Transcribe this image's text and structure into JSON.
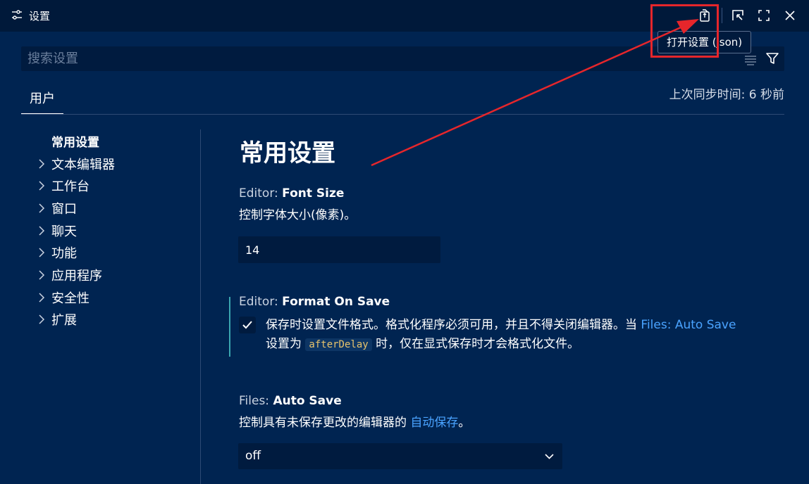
{
  "window": {
    "title": "设置",
    "tooltip": "打开设置 (json)"
  },
  "search": {
    "placeholder": "搜索设置"
  },
  "tabs": [
    {
      "label": "用户"
    }
  ],
  "sync_status": "上次同步时间: 6 秒前",
  "toc": [
    {
      "label": "常用设置",
      "active": true
    },
    {
      "label": "文本编辑器"
    },
    {
      "label": "工作台"
    },
    {
      "label": "窗口"
    },
    {
      "label": "聊天"
    },
    {
      "label": "功能"
    },
    {
      "label": "应用程序"
    },
    {
      "label": "安全性"
    },
    {
      "label": "扩展"
    }
  ],
  "section_title": "常用设置",
  "settings": {
    "font_size": {
      "category": "Editor: ",
      "name": "Font Size",
      "description": "控制字体大小(像素)。",
      "value": "14"
    },
    "format_on_save": {
      "category": "Editor: ",
      "name": "Format On Save",
      "checked": true,
      "desc_part1": "保存时设置文件格式。格式化程序必须可用，并且不得关闭编辑器。当 ",
      "desc_link": "Files: Auto Save",
      "desc_part2": "设置为 ",
      "desc_code": "afterDelay",
      "desc_part3": " 时，仅在显式保存时才会格式化文件。"
    },
    "auto_save": {
      "category": "Files: ",
      "name": "Auto Save",
      "desc_part1": "控制具有未保存更改的编辑器的 ",
      "desc_link": "自动保存",
      "desc_part2": "。",
      "value": "off"
    }
  },
  "colors": {
    "background": "#002451",
    "titlebar": "#00193a",
    "link": "#4aa3ff",
    "highlight": "#e6262b",
    "modified_indicator": "#3aa6b0"
  },
  "icons": [
    "settings-sliders-icon",
    "open-json-icon",
    "split-editor-icon",
    "maximize-icon",
    "close-icon",
    "clear-filter-icon",
    "filter-icon",
    "chevron-right-icon",
    "check-icon",
    "chevron-down-icon"
  ]
}
